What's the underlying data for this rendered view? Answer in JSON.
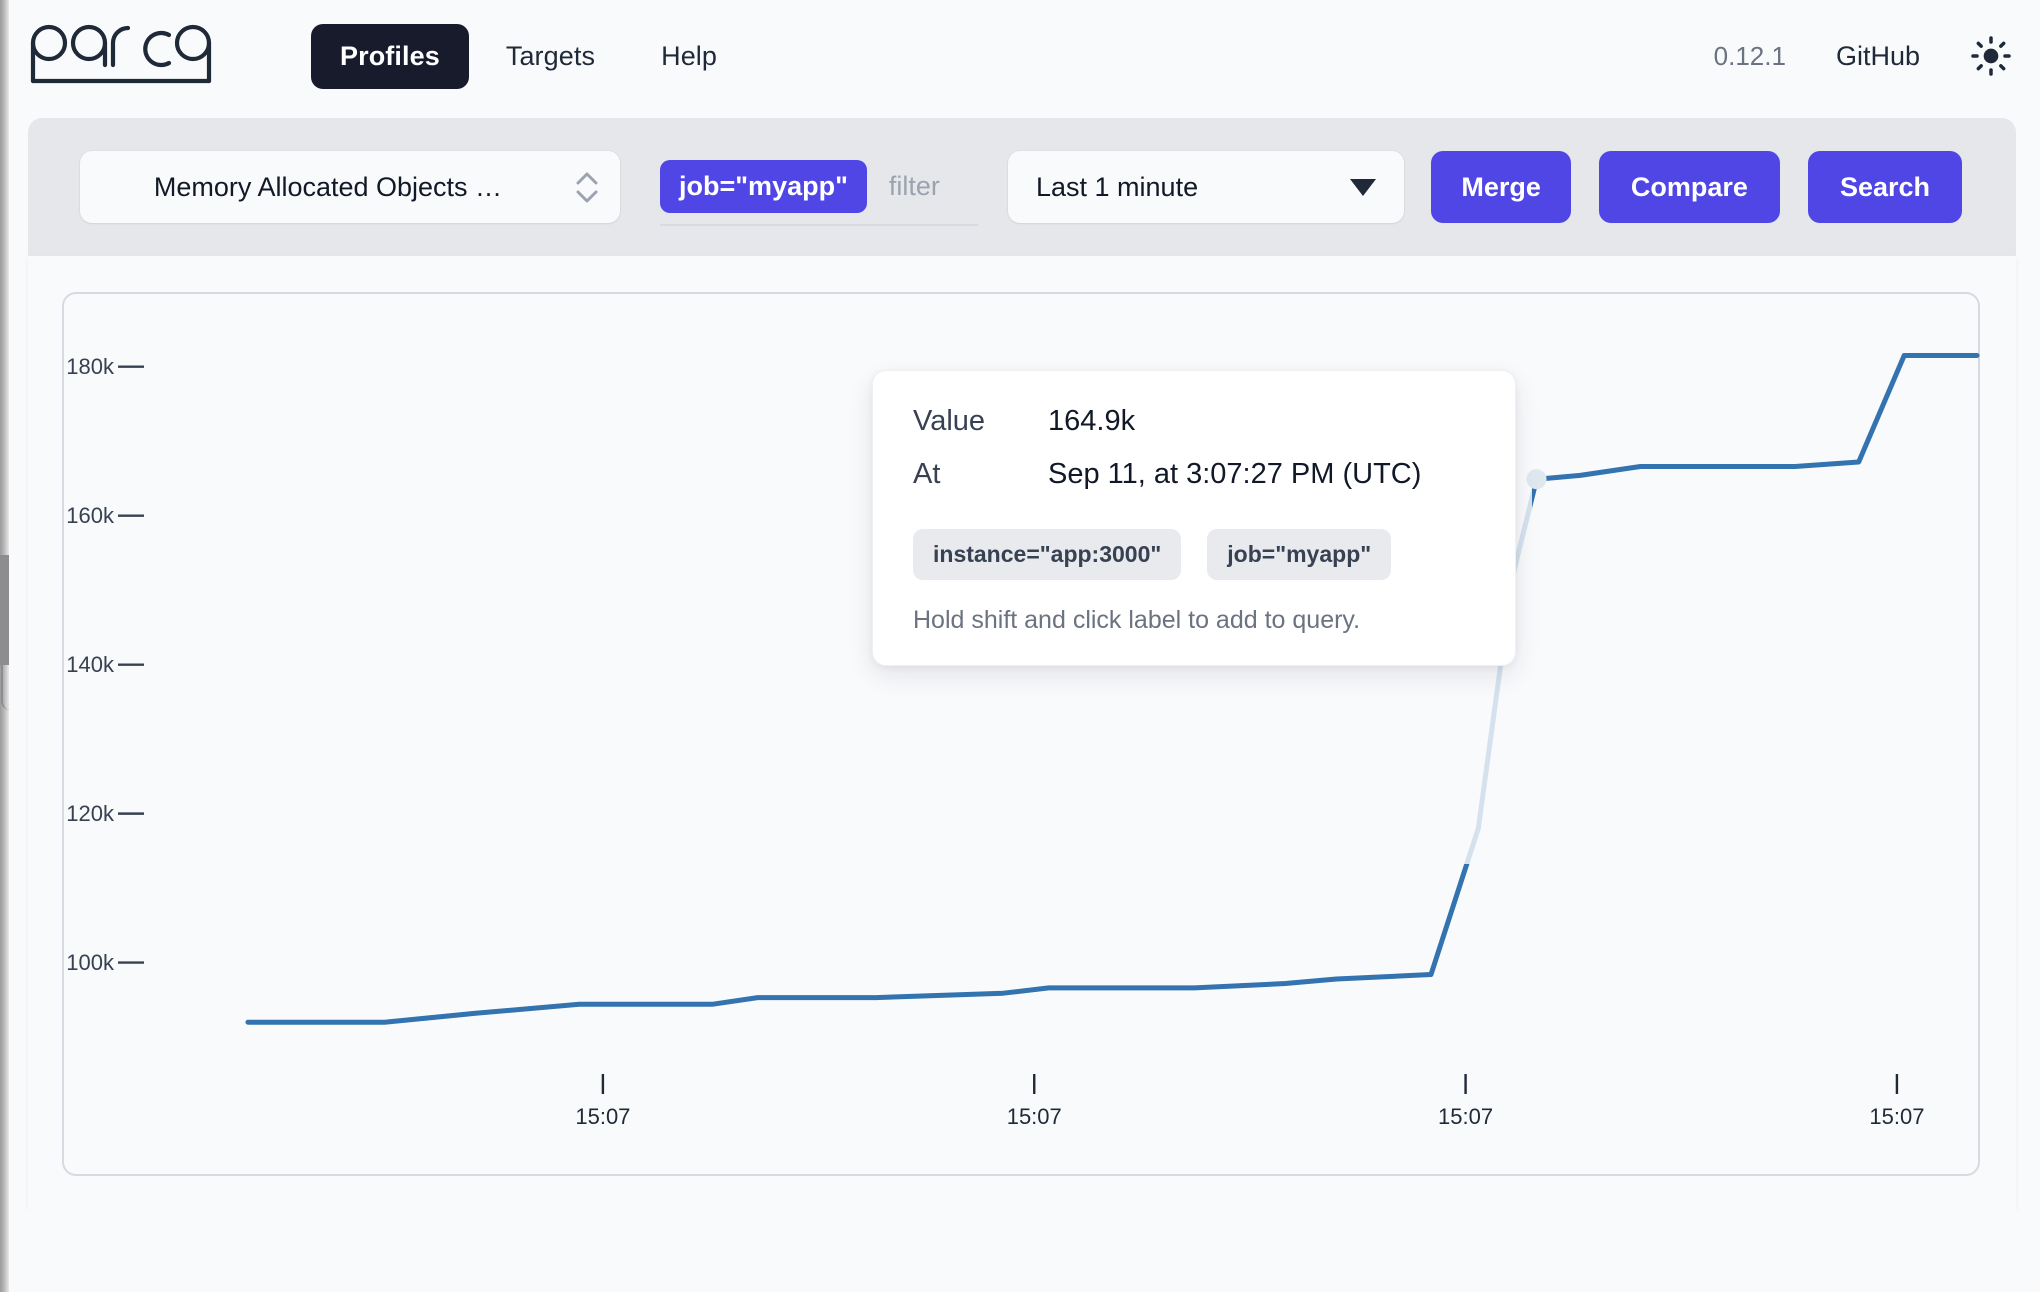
{
  "header": {
    "logo_text": "parca",
    "nav": [
      {
        "label": "Profiles",
        "active": true
      },
      {
        "label": "Targets",
        "active": false
      },
      {
        "label": "Help",
        "active": false
      }
    ],
    "version": "0.12.1",
    "github_label": "GitHub",
    "theme_icon": "sun-icon"
  },
  "toolbar": {
    "profile_select_value": "Memory Allocated Objects …",
    "matcher_pill": "job=\"myapp\"",
    "filter_placeholder": "filter",
    "filter_value": "",
    "time_range_value": "Last 1 minute",
    "merge_label": "Merge",
    "compare_label": "Compare",
    "search_label": "Search"
  },
  "tooltip": {
    "value_key": "Value",
    "value": "164.9k",
    "at_key": "At",
    "at": "Sep 11, at 3:07:27 PM (UTC)",
    "labels": [
      "instance=\"app:3000\"",
      "job=\"myapp\""
    ],
    "hint": "Hold shift and click label to add to query."
  },
  "colors": {
    "accent": "#4f46e5",
    "line": "#3273b0",
    "nav_active_bg": "#171b2c",
    "toolbar_bg": "#e5e7eb",
    "page_bg": "#f8fafc"
  },
  "chart_data": {
    "type": "line",
    "title": "",
    "xlabel": "",
    "ylabel": "",
    "grid": false,
    "legend": null,
    "ylim": [
      88000,
      186000
    ],
    "yticks": [
      100000,
      120000,
      140000,
      160000,
      180000
    ],
    "ytick_labels": [
      "100k",
      "120k",
      "140k",
      "160k",
      "180k"
    ],
    "xtick_labels": [
      "15:07",
      "15:07",
      "15:07",
      "15:07"
    ],
    "xtick_positions": [
      0.245,
      0.482,
      0.719,
      0.956
    ],
    "highlight_point": {
      "x": 0.758,
      "y": 164900,
      "label": "164.9k"
    },
    "series": [
      {
        "name": "Memory Allocated Objects",
        "x": [
          0.05,
          0.125,
          0.175,
          0.232,
          0.305,
          0.33,
          0.395,
          0.465,
          0.49,
          0.57,
          0.62,
          0.648,
          0.7,
          0.726,
          0.745,
          0.758,
          0.782,
          0.815,
          0.9,
          0.935,
          0.96,
          1.0
        ],
        "values": [
          92000,
          92000,
          93200,
          94400,
          94400,
          95300,
          95300,
          95900,
          96600,
          96600,
          97200,
          97800,
          98400,
          118000,
          152000,
          164900,
          165400,
          166600,
          166600,
          167200,
          181500,
          181500
        ]
      }
    ]
  }
}
